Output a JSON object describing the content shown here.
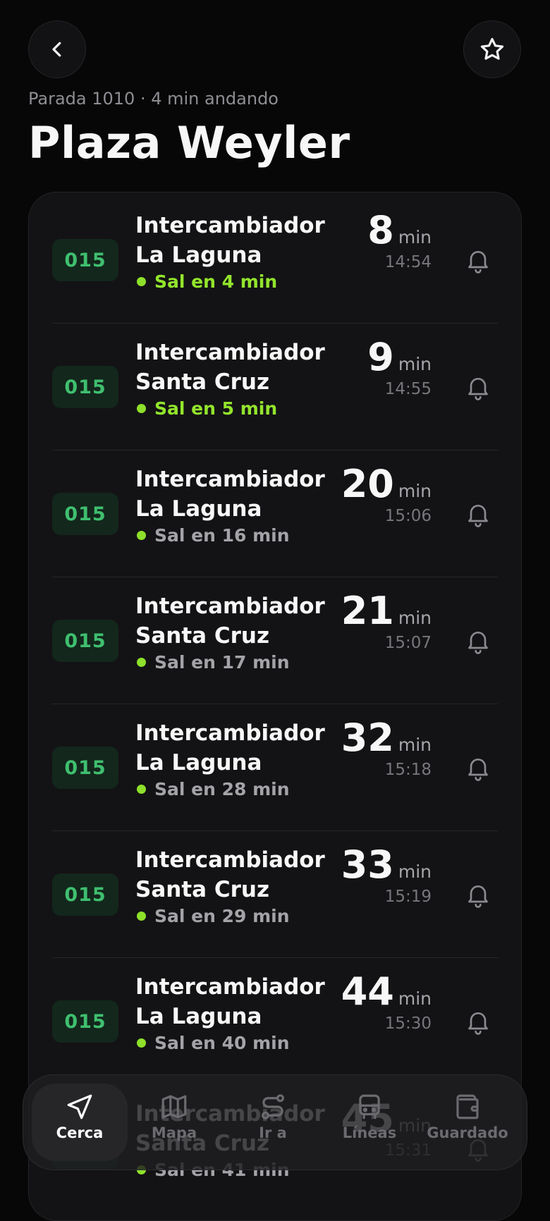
{
  "header": {
    "stop_info": "Parada 1010 · 4 min andando",
    "stop_name": "Plaza Weyler",
    "back_icon": "chevron-left-icon",
    "favorite_icon": "star-icon"
  },
  "colors": {
    "accent_green": "#8ee12a",
    "badge_green": "#3fbf6f",
    "background": "#070708",
    "card": "#131315"
  },
  "departures": [
    {
      "line": "015",
      "dest_line1": "Intercambiador",
      "dest_line2": "La Laguna",
      "depart": "Sal en 4 min",
      "minutes": "8",
      "unit": "min",
      "time": "14:54",
      "soon": true
    },
    {
      "line": "015",
      "dest_line1": "Intercambiador",
      "dest_line2": "Santa Cruz",
      "depart": "Sal en 5 min",
      "minutes": "9",
      "unit": "min",
      "time": "14:55",
      "soon": true
    },
    {
      "line": "015",
      "dest_line1": "Intercambiador",
      "dest_line2": "La Laguna",
      "depart": "Sal en 16 min",
      "minutes": "20",
      "unit": "min",
      "time": "15:06",
      "soon": false
    },
    {
      "line": "015",
      "dest_line1": "Intercambiador",
      "dest_line2": "Santa Cruz",
      "depart": "Sal en 17 min",
      "minutes": "21",
      "unit": "min",
      "time": "15:07",
      "soon": false
    },
    {
      "line": "015",
      "dest_line1": "Intercambiador",
      "dest_line2": "La Laguna",
      "depart": "Sal en 28 min",
      "minutes": "32",
      "unit": "min",
      "time": "15:18",
      "soon": false
    },
    {
      "line": "015",
      "dest_line1": "Intercambiador",
      "dest_line2": "Santa Cruz",
      "depart": "Sal en 29 min",
      "minutes": "33",
      "unit": "min",
      "time": "15:19",
      "soon": false
    },
    {
      "line": "015",
      "dest_line1": "Intercambiador",
      "dest_line2": "La Laguna",
      "depart": "Sal en 40 min",
      "minutes": "44",
      "unit": "min",
      "time": "15:30",
      "soon": false
    },
    {
      "line": "015",
      "dest_line1": "Intercambiador",
      "dest_line2": "Santa Cruz",
      "depart": "Sal en 41 min",
      "minutes": "45",
      "unit": "min",
      "time": "15:31",
      "soon": false
    }
  ],
  "tabbar": {
    "items": [
      {
        "label": "Cerca",
        "icon": "navigation-arrow-icon",
        "active": true
      },
      {
        "label": "Mapa",
        "icon": "map-icon",
        "active": false
      },
      {
        "label": "Ir a",
        "icon": "route-icon",
        "active": false
      },
      {
        "label": "Líneas",
        "icon": "bus-icon",
        "active": false
      },
      {
        "label": "Guardado",
        "icon": "wallet-icon",
        "active": false
      }
    ]
  }
}
